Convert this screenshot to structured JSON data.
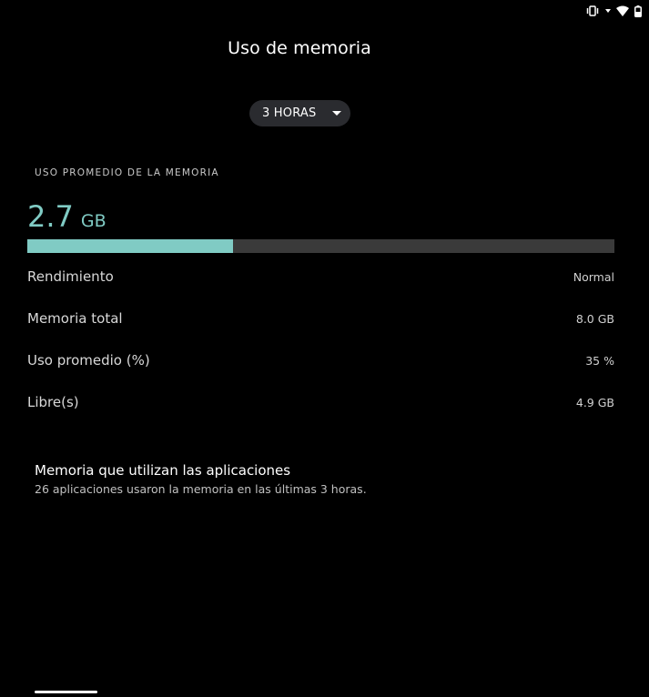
{
  "status_bar": {
    "icons": [
      "vibrate-icon",
      "wifi-icon",
      "signal-arrow-icon",
      "battery-icon"
    ]
  },
  "header": {
    "title": "Uso de memoria"
  },
  "range_selector": {
    "selected": "3 HORAS",
    "icon": "chevron-down-icon"
  },
  "summary": {
    "section_label": "USO PROMEDIO DE LA MEMORIA",
    "used_value": "2.7",
    "used_unit": "GB",
    "usage_fraction": 0.35
  },
  "stats": [
    {
      "label": "Rendimiento",
      "value": "Normal"
    },
    {
      "label": "Memoria total",
      "value": "8.0 GB"
    },
    {
      "label": "Uso promedio (%)",
      "value": "35 %"
    },
    {
      "label": "Libre(s)",
      "value": "4.9 GB"
    }
  ],
  "apps": {
    "title": "Memoria que utilizan las aplicaciones",
    "subtitle": "26 aplicaciones usaron la memoria en las últimas 3 horas."
  },
  "colors": {
    "background": "#000000",
    "accent": "#80cbc4",
    "bar_track": "#3a3a3a",
    "pill_background": "#2a2b2f"
  }
}
